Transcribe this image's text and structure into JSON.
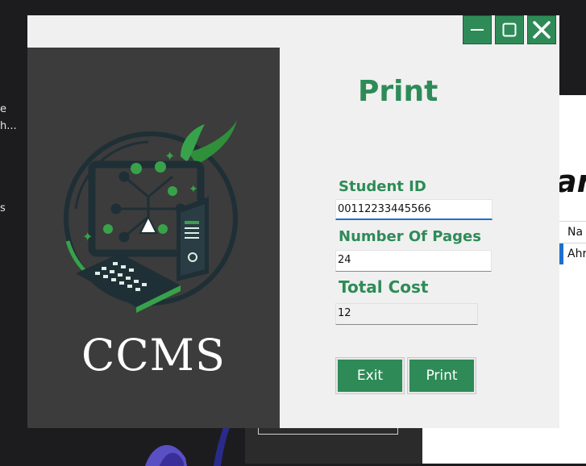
{
  "background": {
    "left_fragments": [
      "e",
      "h...",
      "s"
    ],
    "right_heading": "ar",
    "table_header": "Na",
    "table_row": "Ahr"
  },
  "window": {
    "title": "Print",
    "controls": {
      "minimize": "minimize-icon",
      "maximize": "maximize-icon",
      "close": "close-icon"
    },
    "logo_text": "CCMS",
    "fields": {
      "student_id": {
        "label": "Student ID",
        "value": "00112233445566"
      },
      "pages": {
        "label": "Number Of Pages",
        "value": "24"
      },
      "cost": {
        "label": "Total Cost",
        "value": "12"
      }
    },
    "buttons": {
      "exit": "Exit",
      "print": "Print"
    }
  },
  "colors": {
    "accent_green": "#2e8b57",
    "panel_dark": "#3c3c3c",
    "window_bg": "#f0f0f0",
    "focus_blue": "#1e6fd0"
  }
}
